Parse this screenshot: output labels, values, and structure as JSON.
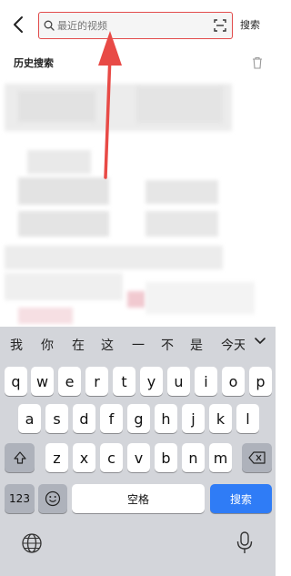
{
  "header": {
    "search_placeholder": "最近的视频",
    "search_button": "搜索"
  },
  "history": {
    "title": "历史搜索"
  },
  "keyboard": {
    "suggestions": [
      "我",
      "你",
      "在",
      "这",
      "一",
      "不",
      "是",
      "今天"
    ],
    "row1": [
      "q",
      "w",
      "e",
      "r",
      "t",
      "y",
      "u",
      "i",
      "o",
      "p"
    ],
    "row2": [
      "a",
      "s",
      "d",
      "f",
      "g",
      "h",
      "j",
      "k",
      "l"
    ],
    "row3": [
      "z",
      "x",
      "c",
      "v",
      "b",
      "n",
      "m"
    ],
    "num_label": "123",
    "space_label": "空格",
    "search_label": "搜索"
  },
  "colors": {
    "highlight": "#e24b4b",
    "keyboard_bg": "#d3d5da",
    "accent": "#2f7cf6"
  }
}
